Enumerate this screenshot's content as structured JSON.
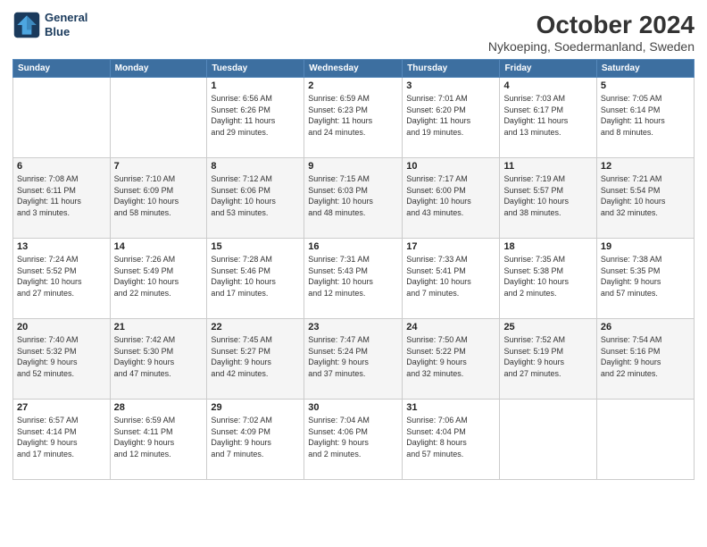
{
  "header": {
    "logo_line1": "General",
    "logo_line2": "Blue",
    "title": "October 2024",
    "subtitle": "Nykoeping, Soedermanland, Sweden"
  },
  "days_of_week": [
    "Sunday",
    "Monday",
    "Tuesday",
    "Wednesday",
    "Thursday",
    "Friday",
    "Saturday"
  ],
  "weeks": [
    [
      {
        "day": "",
        "info": ""
      },
      {
        "day": "",
        "info": ""
      },
      {
        "day": "1",
        "info": "Sunrise: 6:56 AM\nSunset: 6:26 PM\nDaylight: 11 hours\nand 29 minutes."
      },
      {
        "day": "2",
        "info": "Sunrise: 6:59 AM\nSunset: 6:23 PM\nDaylight: 11 hours\nand 24 minutes."
      },
      {
        "day": "3",
        "info": "Sunrise: 7:01 AM\nSunset: 6:20 PM\nDaylight: 11 hours\nand 19 minutes."
      },
      {
        "day": "4",
        "info": "Sunrise: 7:03 AM\nSunset: 6:17 PM\nDaylight: 11 hours\nand 13 minutes."
      },
      {
        "day": "5",
        "info": "Sunrise: 7:05 AM\nSunset: 6:14 PM\nDaylight: 11 hours\nand 8 minutes."
      }
    ],
    [
      {
        "day": "6",
        "info": "Sunrise: 7:08 AM\nSunset: 6:11 PM\nDaylight: 11 hours\nand 3 minutes."
      },
      {
        "day": "7",
        "info": "Sunrise: 7:10 AM\nSunset: 6:09 PM\nDaylight: 10 hours\nand 58 minutes."
      },
      {
        "day": "8",
        "info": "Sunrise: 7:12 AM\nSunset: 6:06 PM\nDaylight: 10 hours\nand 53 minutes."
      },
      {
        "day": "9",
        "info": "Sunrise: 7:15 AM\nSunset: 6:03 PM\nDaylight: 10 hours\nand 48 minutes."
      },
      {
        "day": "10",
        "info": "Sunrise: 7:17 AM\nSunset: 6:00 PM\nDaylight: 10 hours\nand 43 minutes."
      },
      {
        "day": "11",
        "info": "Sunrise: 7:19 AM\nSunset: 5:57 PM\nDaylight: 10 hours\nand 38 minutes."
      },
      {
        "day": "12",
        "info": "Sunrise: 7:21 AM\nSunset: 5:54 PM\nDaylight: 10 hours\nand 32 minutes."
      }
    ],
    [
      {
        "day": "13",
        "info": "Sunrise: 7:24 AM\nSunset: 5:52 PM\nDaylight: 10 hours\nand 27 minutes."
      },
      {
        "day": "14",
        "info": "Sunrise: 7:26 AM\nSunset: 5:49 PM\nDaylight: 10 hours\nand 22 minutes."
      },
      {
        "day": "15",
        "info": "Sunrise: 7:28 AM\nSunset: 5:46 PM\nDaylight: 10 hours\nand 17 minutes."
      },
      {
        "day": "16",
        "info": "Sunrise: 7:31 AM\nSunset: 5:43 PM\nDaylight: 10 hours\nand 12 minutes."
      },
      {
        "day": "17",
        "info": "Sunrise: 7:33 AM\nSunset: 5:41 PM\nDaylight: 10 hours\nand 7 minutes."
      },
      {
        "day": "18",
        "info": "Sunrise: 7:35 AM\nSunset: 5:38 PM\nDaylight: 10 hours\nand 2 minutes."
      },
      {
        "day": "19",
        "info": "Sunrise: 7:38 AM\nSunset: 5:35 PM\nDaylight: 9 hours\nand 57 minutes."
      }
    ],
    [
      {
        "day": "20",
        "info": "Sunrise: 7:40 AM\nSunset: 5:32 PM\nDaylight: 9 hours\nand 52 minutes."
      },
      {
        "day": "21",
        "info": "Sunrise: 7:42 AM\nSunset: 5:30 PM\nDaylight: 9 hours\nand 47 minutes."
      },
      {
        "day": "22",
        "info": "Sunrise: 7:45 AM\nSunset: 5:27 PM\nDaylight: 9 hours\nand 42 minutes."
      },
      {
        "day": "23",
        "info": "Sunrise: 7:47 AM\nSunset: 5:24 PM\nDaylight: 9 hours\nand 37 minutes."
      },
      {
        "day": "24",
        "info": "Sunrise: 7:50 AM\nSunset: 5:22 PM\nDaylight: 9 hours\nand 32 minutes."
      },
      {
        "day": "25",
        "info": "Sunrise: 7:52 AM\nSunset: 5:19 PM\nDaylight: 9 hours\nand 27 minutes."
      },
      {
        "day": "26",
        "info": "Sunrise: 7:54 AM\nSunset: 5:16 PM\nDaylight: 9 hours\nand 22 minutes."
      }
    ],
    [
      {
        "day": "27",
        "info": "Sunrise: 6:57 AM\nSunset: 4:14 PM\nDaylight: 9 hours\nand 17 minutes."
      },
      {
        "day": "28",
        "info": "Sunrise: 6:59 AM\nSunset: 4:11 PM\nDaylight: 9 hours\nand 12 minutes."
      },
      {
        "day": "29",
        "info": "Sunrise: 7:02 AM\nSunset: 4:09 PM\nDaylight: 9 hours\nand 7 minutes."
      },
      {
        "day": "30",
        "info": "Sunrise: 7:04 AM\nSunset: 4:06 PM\nDaylight: 9 hours\nand 2 minutes."
      },
      {
        "day": "31",
        "info": "Sunrise: 7:06 AM\nSunset: 4:04 PM\nDaylight: 8 hours\nand 57 minutes."
      },
      {
        "day": "",
        "info": ""
      },
      {
        "day": "",
        "info": ""
      }
    ]
  ]
}
